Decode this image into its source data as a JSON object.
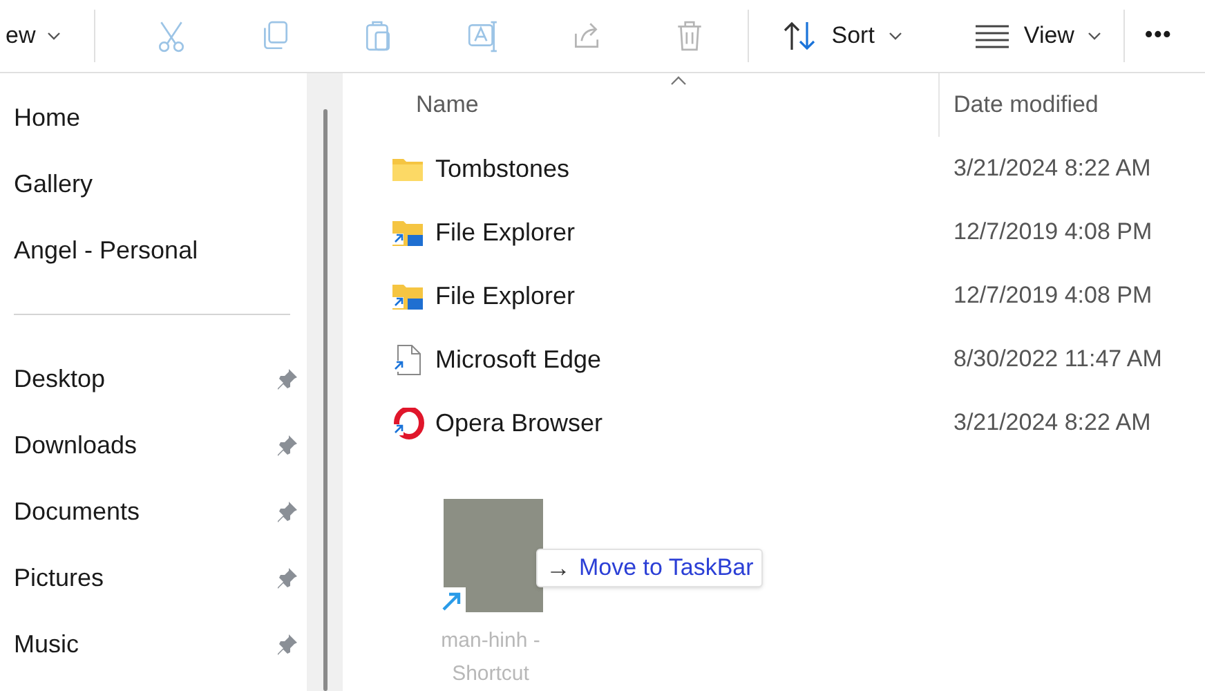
{
  "toolbar": {
    "new_button": {
      "label": "ew"
    },
    "actions": [
      {
        "kind": "cut",
        "disabled": true
      },
      {
        "kind": "copy",
        "disabled": true
      },
      {
        "kind": "paste",
        "disabled": true
      },
      {
        "kind": "rename",
        "disabled": true
      },
      {
        "kind": "share",
        "disabled": true
      },
      {
        "kind": "delete",
        "disabled": true
      }
    ],
    "sort_button": {
      "label": "Sort"
    },
    "view_button": {
      "label": "View"
    },
    "more_button": {
      "label": "•••"
    }
  },
  "sidebar": {
    "items": [
      {
        "label": "Home",
        "pinned": false
      },
      {
        "label": "Gallery",
        "pinned": false
      },
      {
        "label": "Angel - Personal",
        "pinned": false
      }
    ],
    "quick_access": [
      {
        "label": "Desktop",
        "pinned": true
      },
      {
        "label": "Downloads",
        "pinned": true
      },
      {
        "label": "Documents",
        "pinned": true
      },
      {
        "label": "Pictures",
        "pinned": true
      },
      {
        "label": "Music",
        "pinned": true
      }
    ]
  },
  "file_list": {
    "columns": [
      {
        "label": "Name",
        "sorted": true
      },
      {
        "label": "Date modified",
        "sorted": false
      }
    ],
    "rows": [
      {
        "kind": "folder",
        "name": "Tombstones",
        "date": "3/21/2024 8:22 AM"
      },
      {
        "kind": "folder-shortcut",
        "name": "File Explorer",
        "date": "12/7/2019 4:08 PM"
      },
      {
        "kind": "folder-shortcut",
        "name": "File Explorer",
        "date": "12/7/2019 4:08 PM"
      },
      {
        "kind": "file-shortcut",
        "name": "Microsoft Edge",
        "date": "8/30/2022 11:47 AM"
      },
      {
        "kind": "opera-shortcut",
        "name": "Opera Browser",
        "date": "3/21/2024 8:22 AM"
      }
    ]
  },
  "drag": {
    "item_label": "man-hinh - Shortcut",
    "tooltip": {
      "arrow": "→",
      "text": "Move to TaskBar"
    }
  }
}
